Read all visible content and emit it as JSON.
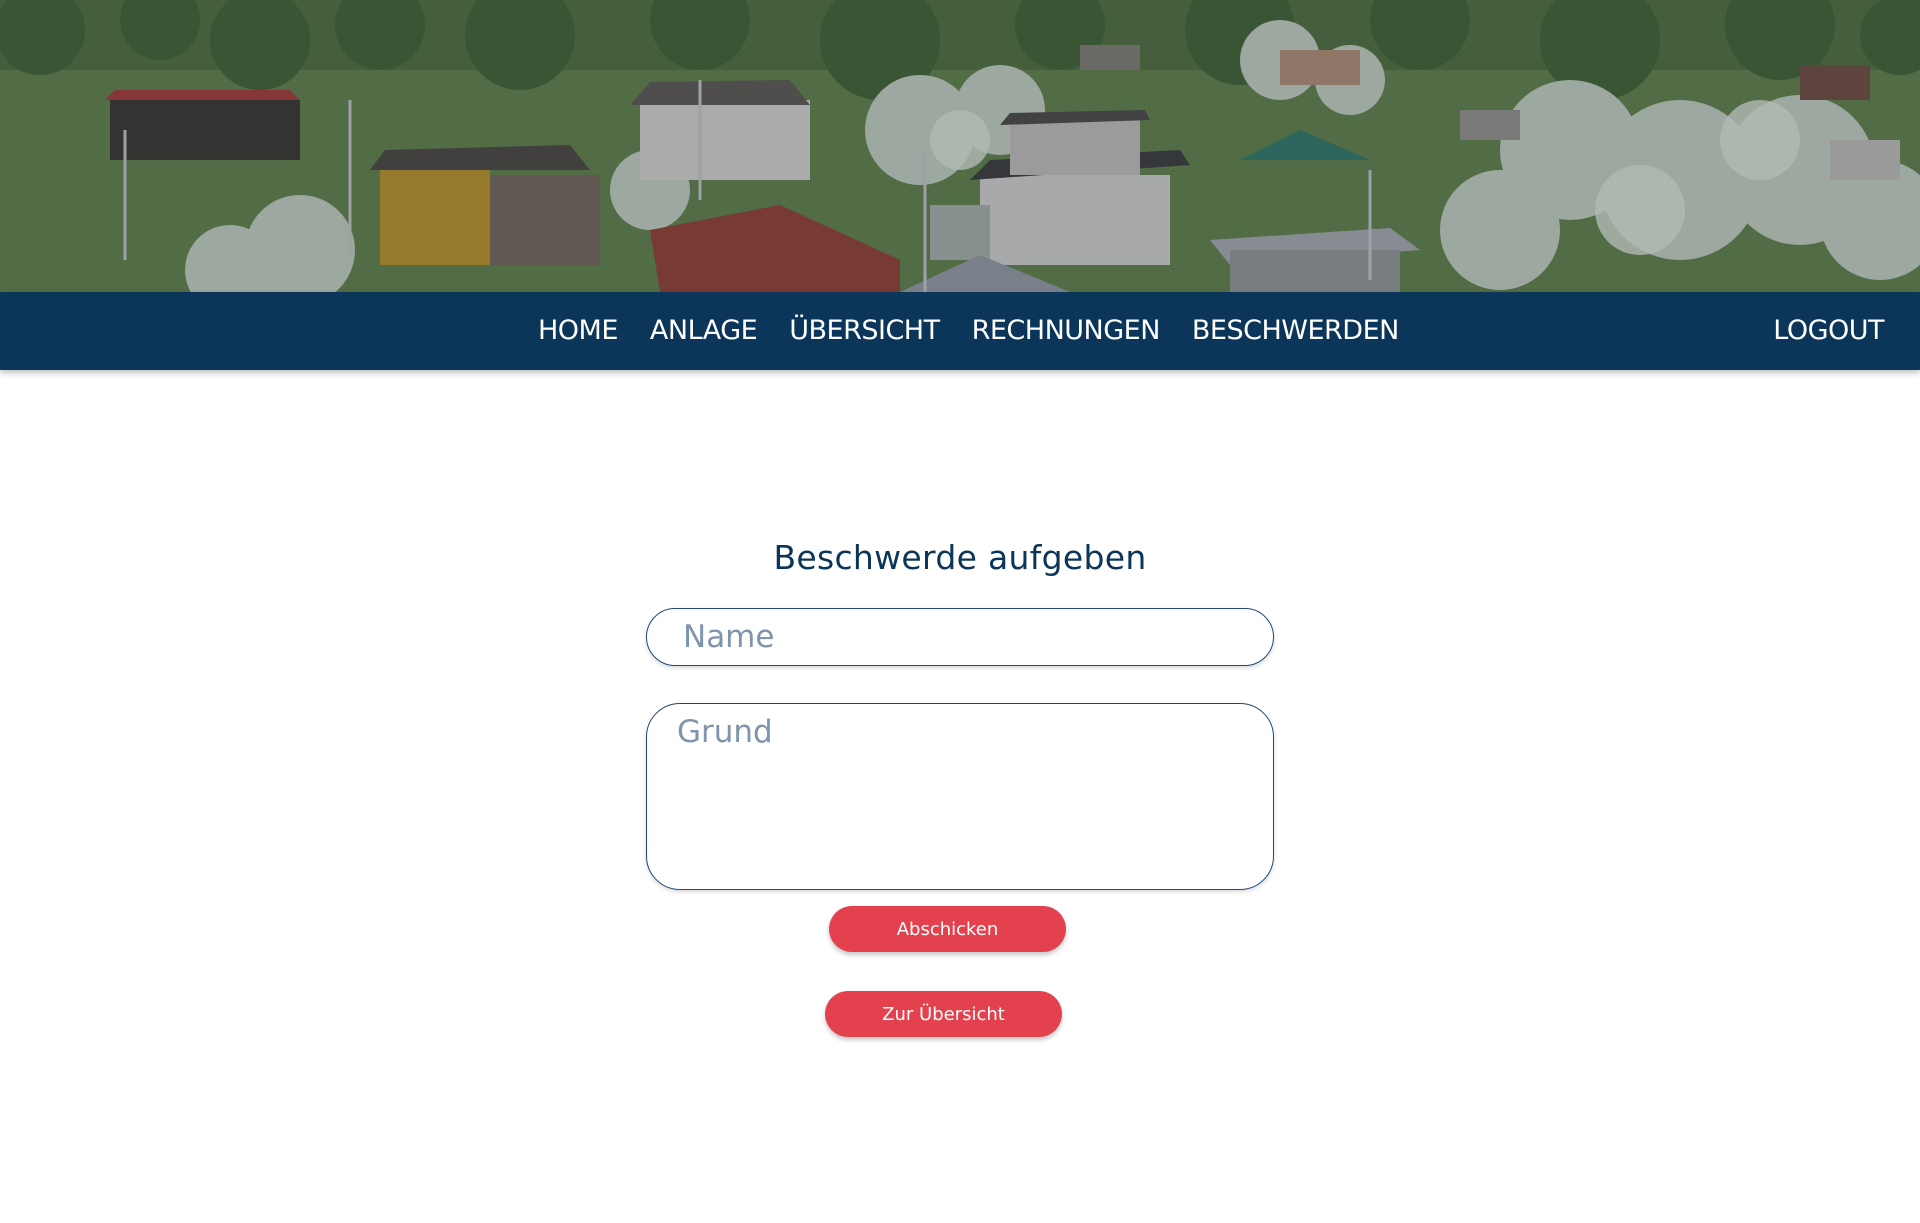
{
  "nav": {
    "items": [
      {
        "label": "HOME"
      },
      {
        "label": "ANLAGE"
      },
      {
        "label": "ÜBERSICHT"
      },
      {
        "label": "RECHNUNGEN"
      },
      {
        "label": "BESCHWERDEN"
      }
    ],
    "logout_label": "LOGOUT"
  },
  "form": {
    "title": "Beschwerde aufgeben",
    "name_placeholder": "Name",
    "reason_placeholder": "Grund",
    "submit_label": "Abschicken",
    "overview_label": "Zur Übersicht"
  },
  "colors": {
    "navbar": "#0b3559",
    "accent_button": "#e2414d",
    "title": "#0b3559"
  }
}
